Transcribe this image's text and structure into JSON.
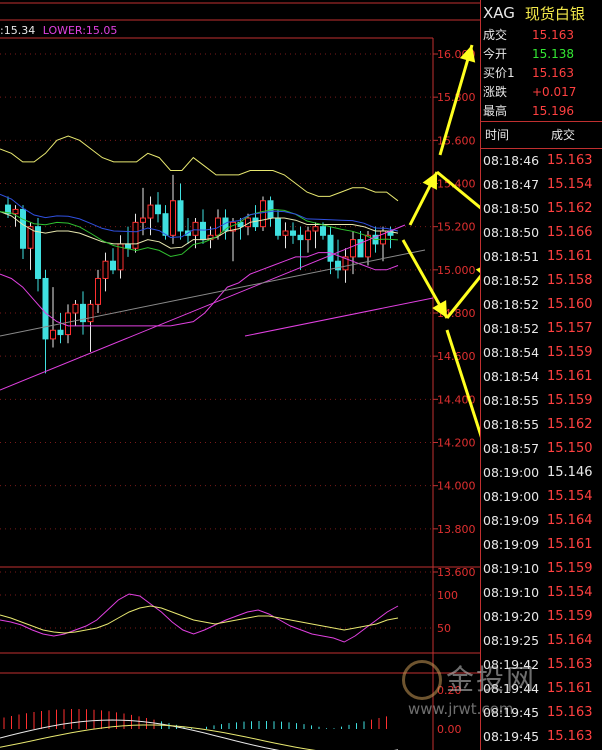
{
  "indicator": {
    "upper_label": ":15.34",
    "lower_label": "LOWER:15.05"
  },
  "panel": {
    "symbol": "XAG",
    "name": "现货白银",
    "quotes": [
      {
        "label": "成交",
        "value": "15.163",
        "color": "red"
      },
      {
        "label": "今开",
        "value": "15.138",
        "color": "green"
      },
      {
        "label": "买价1",
        "value": "15.163",
        "color": "red"
      },
      {
        "label": "涨跌",
        "value": "+0.017",
        "color": "red"
      },
      {
        "label": "最高",
        "value": "15.196",
        "color": "red"
      }
    ],
    "trade_header": {
      "time": "时间",
      "deal": "成交"
    },
    "trades": [
      {
        "time": "08:18:46",
        "price": "15.163",
        "color": "red"
      },
      {
        "time": "08:18:47",
        "price": "15.154",
        "color": "red"
      },
      {
        "time": "08:18:50",
        "price": "15.162",
        "color": "red"
      },
      {
        "time": "08:18:50",
        "price": "15.166",
        "color": "red"
      },
      {
        "time": "08:18:51",
        "price": "15.161",
        "color": "red"
      },
      {
        "time": "08:18:52",
        "price": "15.158",
        "color": "red"
      },
      {
        "time": "08:18:52",
        "price": "15.160",
        "color": "red"
      },
      {
        "time": "08:18:52",
        "price": "15.157",
        "color": "red"
      },
      {
        "time": "08:18:54",
        "price": "15.159",
        "color": "red"
      },
      {
        "time": "08:18:54",
        "price": "15.161",
        "color": "red"
      },
      {
        "time": "08:18:55",
        "price": "15.159",
        "color": "red"
      },
      {
        "time": "08:18:55",
        "price": "15.162",
        "color": "red"
      },
      {
        "time": "08:18:57",
        "price": "15.150",
        "color": "red"
      },
      {
        "time": "08:19:00",
        "price": "15.146",
        "color": "white"
      },
      {
        "time": "08:19:00",
        "price": "15.154",
        "color": "red"
      },
      {
        "time": "08:19:09",
        "price": "15.164",
        "color": "red"
      },
      {
        "time": "08:19:09",
        "price": "15.161",
        "color": "red"
      },
      {
        "time": "08:19:10",
        "price": "15.159",
        "color": "red"
      },
      {
        "time": "08:19:10",
        "price": "15.154",
        "color": "red"
      },
      {
        "time": "08:19:20",
        "price": "15.159",
        "color": "red"
      },
      {
        "time": "08:19:25",
        "price": "15.164",
        "color": "red"
      },
      {
        "time": "08:19:42",
        "price": "15.163",
        "color": "red"
      },
      {
        "time": "08:19:44",
        "price": "15.161",
        "color": "red"
      },
      {
        "time": "08:19:45",
        "price": "15.163",
        "color": "red"
      },
      {
        "time": "08:19:45",
        "price": "15.163",
        "color": "red"
      }
    ]
  },
  "watermark": {
    "brand": "金投网",
    "url": "www.jrwt.com"
  },
  "colors": {
    "up": "#ff3030",
    "down": "#40e0e0",
    "axis": "#c03030",
    "upper_band": "#e8e870",
    "lower_band": "#e040e0",
    "arrow": "#ffff20"
  },
  "chart_data": {
    "type": "candlestick",
    "y_ticks": [
      "16.000",
      "15.800",
      "15.600",
      "15.400",
      "15.200",
      "15.000",
      "14.800",
      "14.600",
      "14.400",
      "14.200",
      "14.000",
      "13.800",
      "13.600"
    ],
    "ylim": [
      13.6,
      16.0
    ],
    "candles": [
      {
        "o": 15.3,
        "h": 15.34,
        "l": 15.24,
        "c": 15.26
      },
      {
        "o": 15.26,
        "h": 15.3,
        "l": 15.2,
        "c": 15.28
      },
      {
        "o": 15.28,
        "h": 15.3,
        "l": 15.05,
        "c": 15.1
      },
      {
        "o": 15.1,
        "h": 15.22,
        "l": 15.0,
        "c": 15.2
      },
      {
        "o": 15.2,
        "h": 15.24,
        "l": 14.9,
        "c": 14.96
      },
      {
        "o": 14.96,
        "h": 15.0,
        "l": 14.52,
        "c": 14.68
      },
      {
        "o": 14.68,
        "h": 14.92,
        "l": 14.64,
        "c": 14.72
      },
      {
        "o": 14.72,
        "h": 14.8,
        "l": 14.66,
        "c": 14.7
      },
      {
        "o": 14.7,
        "h": 14.84,
        "l": 14.66,
        "c": 14.8
      },
      {
        "o": 14.8,
        "h": 14.86,
        "l": 14.74,
        "c": 14.84
      },
      {
        "o": 14.84,
        "h": 14.9,
        "l": 14.7,
        "c": 14.76
      },
      {
        "o": 14.76,
        "h": 14.86,
        "l": 14.62,
        "c": 14.84
      },
      {
        "o": 14.84,
        "h": 15.0,
        "l": 14.8,
        "c": 14.96
      },
      {
        "o": 14.96,
        "h": 15.08,
        "l": 14.9,
        "c": 15.04
      },
      {
        "o": 15.04,
        "h": 15.1,
        "l": 14.98,
        "c": 15.0
      },
      {
        "o": 15.0,
        "h": 15.16,
        "l": 14.96,
        "c": 15.12
      },
      {
        "o": 15.12,
        "h": 15.2,
        "l": 15.06,
        "c": 15.1
      },
      {
        "o": 15.1,
        "h": 15.26,
        "l": 15.08,
        "c": 15.22
      },
      {
        "o": 15.22,
        "h": 15.38,
        "l": 15.16,
        "c": 15.24
      },
      {
        "o": 15.24,
        "h": 15.34,
        "l": 15.16,
        "c": 15.3
      },
      {
        "o": 15.3,
        "h": 15.36,
        "l": 15.22,
        "c": 15.26
      },
      {
        "o": 15.26,
        "h": 15.3,
        "l": 15.14,
        "c": 15.16
      },
      {
        "o": 15.16,
        "h": 15.44,
        "l": 15.12,
        "c": 15.32
      },
      {
        "o": 15.32,
        "h": 15.4,
        "l": 15.14,
        "c": 15.18
      },
      {
        "o": 15.18,
        "h": 15.24,
        "l": 15.12,
        "c": 15.16
      },
      {
        "o": 15.16,
        "h": 15.24,
        "l": 15.1,
        "c": 15.22
      },
      {
        "o": 15.22,
        "h": 15.28,
        "l": 15.12,
        "c": 15.14
      },
      {
        "o": 15.14,
        "h": 15.2,
        "l": 15.1,
        "c": 15.16
      },
      {
        "o": 15.16,
        "h": 15.28,
        "l": 15.14,
        "c": 15.24
      },
      {
        "o": 15.24,
        "h": 15.28,
        "l": 15.14,
        "c": 15.18
      },
      {
        "o": 15.18,
        "h": 15.24,
        "l": 15.04,
        "c": 15.22
      },
      {
        "o": 15.22,
        "h": 15.24,
        "l": 15.14,
        "c": 15.2
      },
      {
        "o": 15.2,
        "h": 15.26,
        "l": 15.16,
        "c": 15.24
      },
      {
        "o": 15.24,
        "h": 15.3,
        "l": 15.18,
        "c": 15.2
      },
      {
        "o": 15.2,
        "h": 15.34,
        "l": 15.18,
        "c": 15.32
      },
      {
        "o": 15.32,
        "h": 15.34,
        "l": 15.2,
        "c": 15.24
      },
      {
        "o": 15.24,
        "h": 15.28,
        "l": 15.14,
        "c": 15.16
      },
      {
        "o": 15.16,
        "h": 15.22,
        "l": 15.1,
        "c": 15.18
      },
      {
        "o": 15.18,
        "h": 15.22,
        "l": 15.12,
        "c": 15.16
      },
      {
        "o": 15.16,
        "h": 15.2,
        "l": 15.0,
        "c": 15.14
      },
      {
        "o": 15.14,
        "h": 15.2,
        "l": 15.08,
        "c": 15.18
      },
      {
        "o": 15.18,
        "h": 15.22,
        "l": 15.1,
        "c": 15.2
      },
      {
        "o": 15.2,
        "h": 15.22,
        "l": 15.14,
        "c": 15.16
      },
      {
        "o": 15.16,
        "h": 15.2,
        "l": 14.98,
        "c": 15.04
      },
      {
        "o": 15.04,
        "h": 15.14,
        "l": 14.96,
        "c": 15.0
      },
      {
        "o": 15.0,
        "h": 15.1,
        "l": 14.94,
        "c": 15.06
      },
      {
        "o": 15.06,
        "h": 15.18,
        "l": 14.98,
        "c": 15.14
      },
      {
        "o": 15.14,
        "h": 15.18,
        "l": 15.06,
        "c": 15.06
      },
      {
        "o": 15.06,
        "h": 15.18,
        "l": 15.02,
        "c": 15.16
      },
      {
        "o": 15.16,
        "h": 15.2,
        "l": 15.08,
        "c": 15.12
      },
      {
        "o": 15.12,
        "h": 15.2,
        "l": 15.04,
        "c": 15.18
      },
      {
        "o": 15.18,
        "h": 15.2,
        "l": 15.1,
        "c": 15.16
      }
    ],
    "upper_band": [
      15.56,
      15.54,
      15.5,
      15.5,
      15.54,
      15.6,
      15.62,
      15.6,
      15.56,
      15.52,
      15.5,
      15.5,
      15.5,
      15.54,
      15.52,
      15.46,
      15.46,
      15.52,
      15.48,
      15.44,
      15.44,
      15.44,
      15.46,
      15.46,
      15.46,
      15.44,
      15.4,
      15.36,
      15.34,
      15.34,
      15.36,
      15.38,
      15.38,
      15.36,
      15.36,
      15.32
    ],
    "lower_band": [
      14.98,
      14.96,
      14.92,
      14.86,
      14.8,
      14.76,
      14.74,
      14.74,
      14.74,
      14.74,
      14.74,
      14.74,
      14.74,
      14.74,
      14.74,
      14.74,
      14.75,
      14.76,
      14.8,
      14.86,
      14.92,
      14.94,
      14.98,
      15.0,
      15.02,
      15.04,
      15.06,
      15.06,
      15.08,
      15.08,
      15.06,
      15.04,
      15.02,
      15.0,
      15.0,
      15.02
    ],
    "oscillator_ticks": [
      "100",
      "50"
    ],
    "macd_ticks": [
      "0.20",
      "0.00"
    ]
  }
}
